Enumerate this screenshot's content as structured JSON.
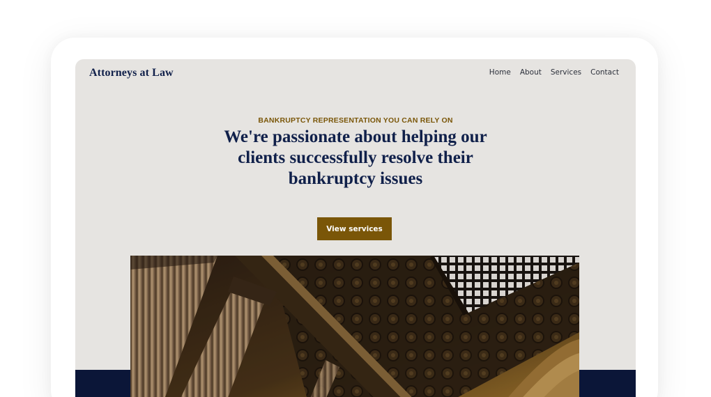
{
  "colors": {
    "navy": "#10204a",
    "gold": "#7a5608",
    "page_bg": "#e6e4e1",
    "band": "#0b1638"
  },
  "header": {
    "brand": "Attorneys at Law",
    "nav": [
      {
        "label": "Home"
      },
      {
        "label": "About"
      },
      {
        "label": "Services"
      },
      {
        "label": "Contact"
      }
    ]
  },
  "hero": {
    "eyebrow": "BANKRUPTCY REPRESENTATION YOU CAN RELY ON",
    "headline_lines": [
      "We're passionate about helping our",
      "clients successfully resolve their",
      "bankruptcy issues"
    ],
    "cta_label": "View services",
    "image": {
      "icon": "courthouse-columns-photo"
    }
  }
}
